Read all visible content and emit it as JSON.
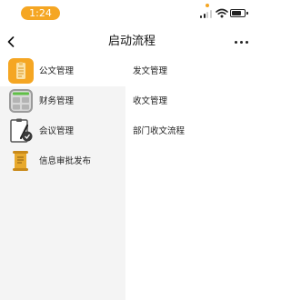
{
  "status_bar": {
    "time": "1:24",
    "signal_icon": "cellular-signal-icon",
    "wifi_icon": "wifi-icon",
    "battery_icon": "battery-icon",
    "accent_color": "#f5a623"
  },
  "nav": {
    "title": "启动流程",
    "back_icon": "chevron-left-icon",
    "more_icon": "more-dots-icon"
  },
  "categories": [
    {
      "label": "公文管理",
      "icon": "document-folder-icon",
      "selected": true
    },
    {
      "label": "财务管理",
      "icon": "calculator-icon",
      "selected": false
    },
    {
      "label": "会议管理",
      "icon": "clipboard-pen-icon",
      "selected": false
    },
    {
      "label": "信息审批发布",
      "icon": "scroll-icon",
      "selected": false
    }
  ],
  "subitems": [
    {
      "label": "发文管理"
    },
    {
      "label": "收文管理"
    },
    {
      "label": "部门收文流程"
    }
  ]
}
